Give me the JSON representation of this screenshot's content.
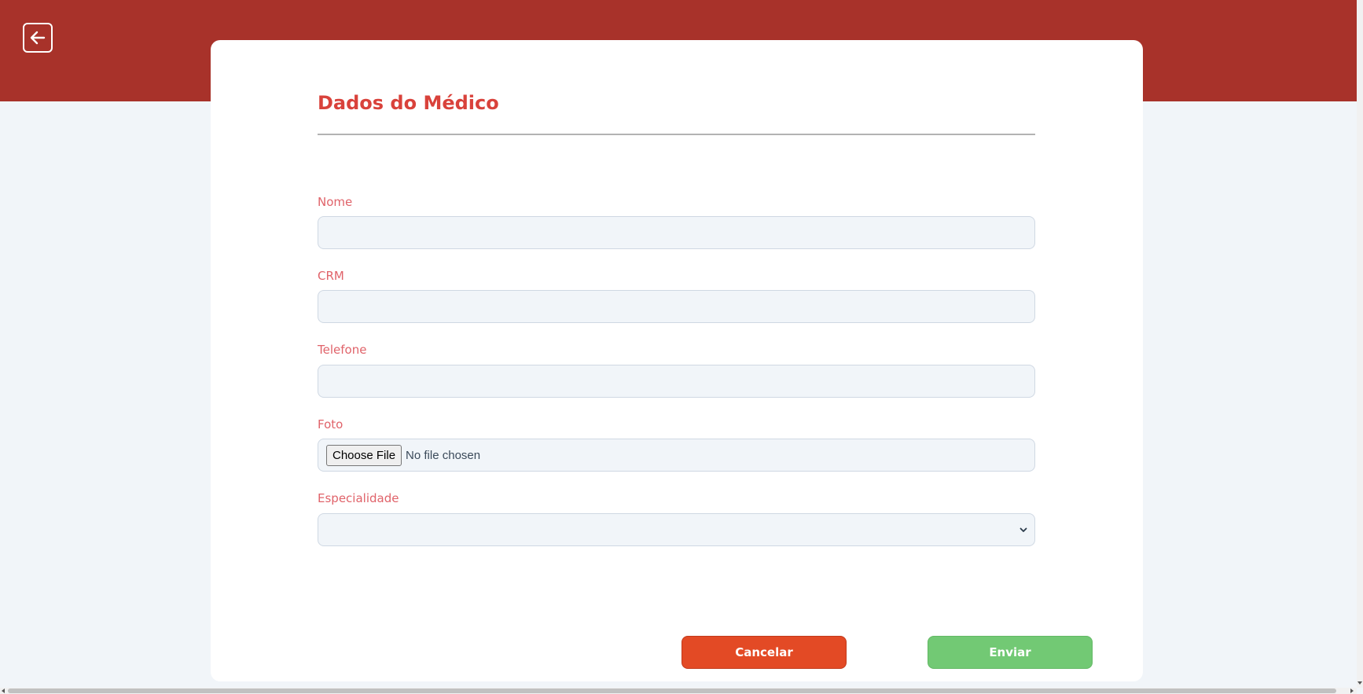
{
  "header": {
    "back_icon": "arrow-left-icon",
    "band_color": "#a8322a"
  },
  "form": {
    "title": "Dados do Médico",
    "title_color": "#d9423b",
    "label_color": "#e0636a",
    "fields": {
      "nome": {
        "label": "Nome",
        "value": "",
        "placeholder": ""
      },
      "crm": {
        "label": "CRM",
        "value": "",
        "placeholder": ""
      },
      "telefone": {
        "label": "Telefone",
        "value": "",
        "placeholder": ""
      },
      "foto": {
        "label": "Foto",
        "button_label": "Choose File",
        "status": "No file chosen"
      },
      "especialidade": {
        "label": "Especialidade",
        "selected": ""
      }
    }
  },
  "actions": {
    "cancel_label": "Cancelar",
    "cancel_color": "#e34a25",
    "submit_label": "Enviar",
    "submit_color": "#72c974"
  }
}
